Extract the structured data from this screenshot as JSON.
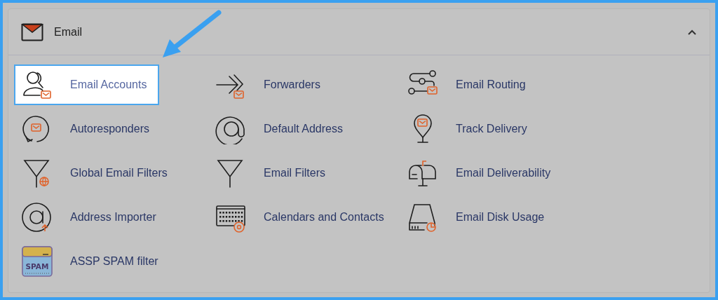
{
  "section": {
    "title": "Email",
    "expanded": true
  },
  "items": [
    {
      "label": "Email Accounts",
      "selected": true
    },
    {
      "label": "Forwarders",
      "selected": false
    },
    {
      "label": "Email Routing",
      "selected": false
    },
    {
      "label": "Autoresponders",
      "selected": false
    },
    {
      "label": "Default Address",
      "selected": false
    },
    {
      "label": "Track Delivery",
      "selected": false
    },
    {
      "label": "Global Email Filters",
      "selected": false
    },
    {
      "label": "Email Filters",
      "selected": false
    },
    {
      "label": "Email Deliverability",
      "selected": false
    },
    {
      "label": "Address Importer",
      "selected": false
    },
    {
      "label": "Calendars and Contacts",
      "selected": false
    },
    {
      "label": "Email Disk Usage",
      "selected": false
    },
    {
      "label": "ASSP SPAM filter",
      "selected": false,
      "icon_text": "SPAM"
    }
  ]
}
